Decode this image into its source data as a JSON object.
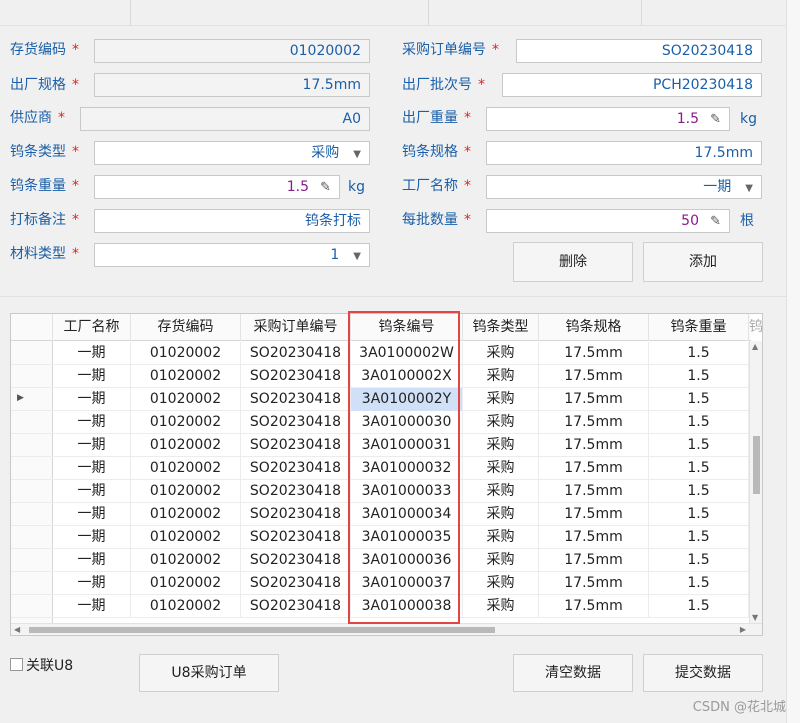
{
  "form": {
    "left": [
      {
        "label": "存货编码",
        "value": "01020002",
        "readonly": true
      },
      {
        "label": "出厂规格",
        "value": "17.5mm",
        "readonly": true
      },
      {
        "label": "供应商",
        "value": "A0",
        "readonly": true
      },
      {
        "label": "钨条类型",
        "value": "采购"
      },
      {
        "label": "钨条重量",
        "value": "1.5",
        "unit": "kg"
      },
      {
        "label": "打标备注",
        "value": "钨条打标"
      },
      {
        "label": "材料类型",
        "value": "1"
      }
    ],
    "right": [
      {
        "label": "采购订单编号",
        "value": "SO20230418"
      },
      {
        "label": "出厂批次号",
        "value": "PCH20230418"
      },
      {
        "label": "出厂重量",
        "value": "1.5",
        "unit": "kg"
      },
      {
        "label": "钨条规格",
        "value": "17.5mm"
      },
      {
        "label": "工厂名称",
        "value": "一期"
      },
      {
        "label": "每批数量",
        "value": "50",
        "unit": "根"
      }
    ]
  },
  "buttons": {
    "delete": "删除",
    "add": "添加",
    "u8_purchase": "U8采购订单",
    "clear": "清空数据",
    "submit": "提交数据"
  },
  "checkbox": {
    "label": "关联U8",
    "checked": false
  },
  "grid": {
    "columns": [
      "工厂名称",
      "存货编码",
      "采购订单编号",
      "钨条编号",
      "钨条类型",
      "钨条规格",
      "钨条重量",
      "钨"
    ],
    "rows": [
      [
        "一期",
        "01020002",
        "SO20230418",
        "3A0100002W",
        "采购",
        "17.5mm",
        "1.5"
      ],
      [
        "一期",
        "01020002",
        "SO20230418",
        "3A0100002X",
        "采购",
        "17.5mm",
        "1.5"
      ],
      [
        "一期",
        "01020002",
        "SO20230418",
        "3A0100002Y",
        "采购",
        "17.5mm",
        "1.5"
      ],
      [
        "一期",
        "01020002",
        "SO20230418",
        "3A01000030",
        "采购",
        "17.5mm",
        "1.5"
      ],
      [
        "一期",
        "01020002",
        "SO20230418",
        "3A01000031",
        "采购",
        "17.5mm",
        "1.5"
      ],
      [
        "一期",
        "01020002",
        "SO20230418",
        "3A01000032",
        "采购",
        "17.5mm",
        "1.5"
      ],
      [
        "一期",
        "01020002",
        "SO20230418",
        "3A01000033",
        "采购",
        "17.5mm",
        "1.5"
      ],
      [
        "一期",
        "01020002",
        "SO20230418",
        "3A01000034",
        "采购",
        "17.5mm",
        "1.5"
      ],
      [
        "一期",
        "01020002",
        "SO20230418",
        "3A01000035",
        "采购",
        "17.5mm",
        "1.5"
      ],
      [
        "一期",
        "01020002",
        "SO20230418",
        "3A01000036",
        "采购",
        "17.5mm",
        "1.5"
      ],
      [
        "一期",
        "01020002",
        "SO20230418",
        "3A01000037",
        "采购",
        "17.5mm",
        "1.5"
      ],
      [
        "一期",
        "01020002",
        "SO20230418",
        "3A01000038",
        "采购",
        "17.5mm",
        "1.5"
      ]
    ],
    "selected_row": 2,
    "selected_col": 3
  },
  "watermark": "CSDN @花北城",
  "colors": {
    "label": "#1a5fa8",
    "required": "#e02424",
    "highlight": "#e24545",
    "selected": "#cfe0f7"
  }
}
